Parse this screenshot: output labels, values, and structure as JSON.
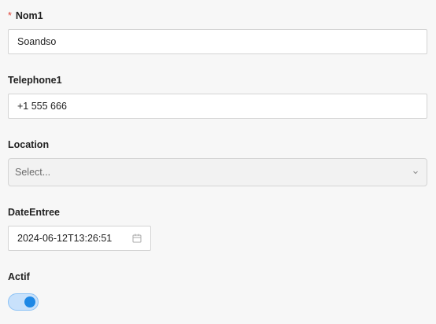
{
  "form": {
    "fields": {
      "nom": {
        "label": "Nom1",
        "required_mark": "*",
        "value": "Soandso"
      },
      "telephone": {
        "label": "Telephone1",
        "value": "+1 555 666"
      },
      "location": {
        "label": "Location",
        "placeholder": "Select...",
        "icon": "chevron-down-icon"
      },
      "date": {
        "label": "DateEntree",
        "value": "2024-06-12T13:26:51",
        "icon": "calendar-icon"
      },
      "actif": {
        "label": "Actif",
        "checked": true
      }
    }
  },
  "colors": {
    "background": "#f7f7f7",
    "required": "#e0453a",
    "toggle_on": "#1e88e5"
  }
}
